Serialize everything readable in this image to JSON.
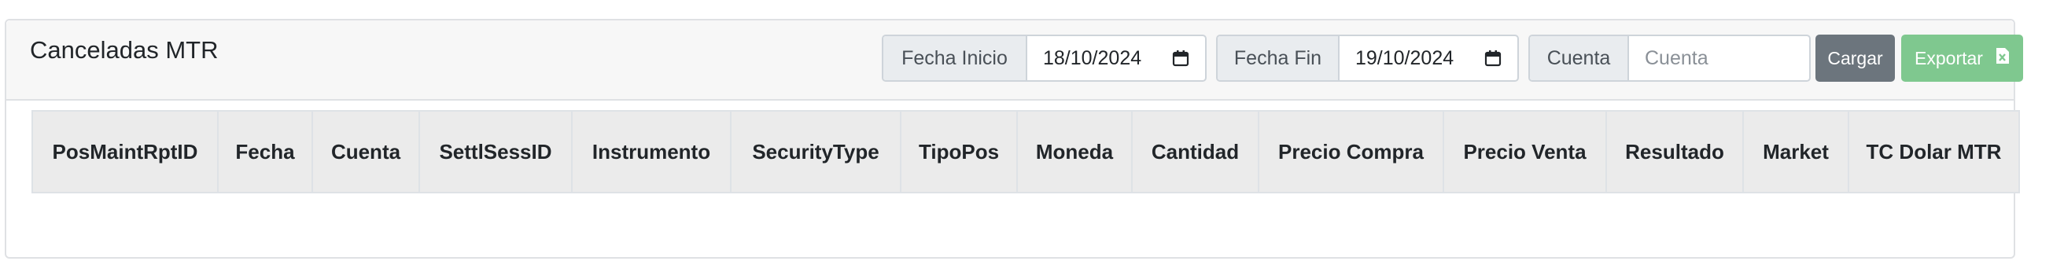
{
  "header": {
    "title": "Canceladas MTR"
  },
  "filters": {
    "fecha_inicio": {
      "label": "Fecha Inicio",
      "value": "18/10/2024"
    },
    "fecha_fin": {
      "label": "Fecha Fin",
      "value": "19/10/2024"
    },
    "cuenta": {
      "label": "Cuenta",
      "placeholder": "Cuenta"
    }
  },
  "actions": {
    "cargar_label": "Cargar",
    "exportar_label": "Exportar"
  },
  "table": {
    "columns": [
      "PosMaintRptID",
      "Fecha",
      "Cuenta",
      "SettlSessID",
      "Instrumento",
      "SecurityType",
      "TipoPos",
      "Moneda",
      "Cantidad",
      "Precio Compra",
      "Precio Venta",
      "Resultado",
      "Market",
      "TC Dolar MTR"
    ],
    "rows": []
  },
  "icons": {
    "calendar": "calendar-icon",
    "excel": "excel-file-icon"
  },
  "colors": {
    "cargar_button": "#6c757d",
    "exportar_button": "#7fc88f",
    "header_bg": "#f7f7f7",
    "table_header_bg": "#ebebeb"
  }
}
